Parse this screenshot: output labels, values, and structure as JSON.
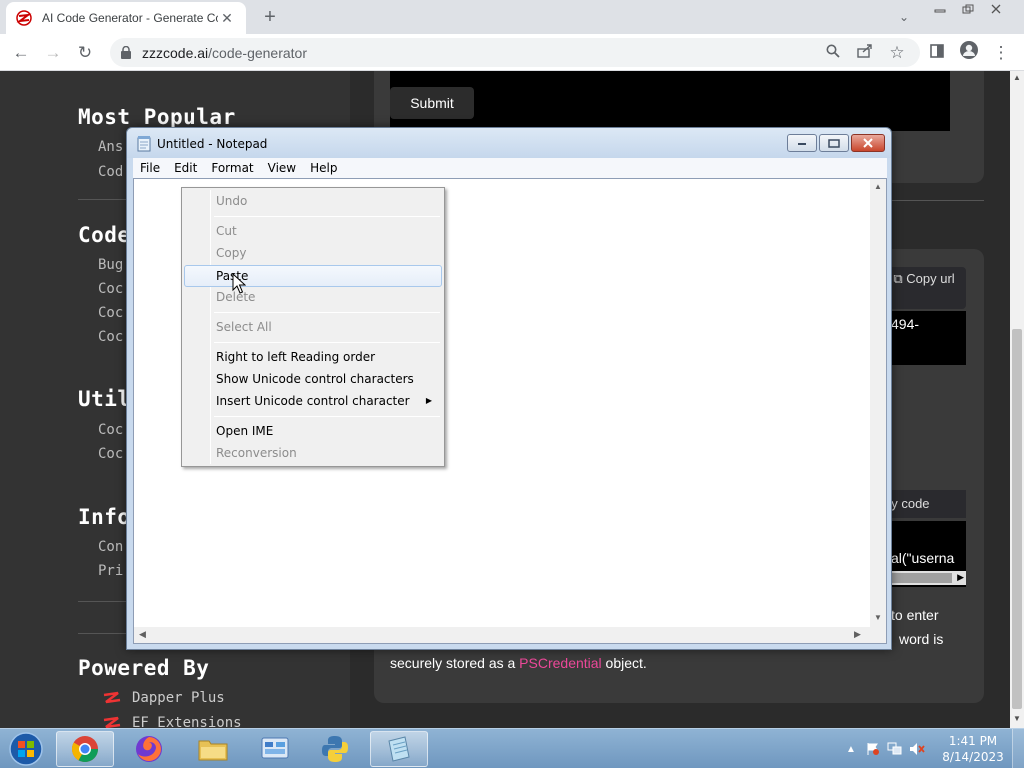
{
  "browser": {
    "tab_title": "AI Code Generator - Generate Cc",
    "url_host": "zzzcode.ai",
    "url_path": "/code-generator"
  },
  "site": {
    "sidebar": {
      "headings": [
        "Most Popular",
        "Code",
        "Util",
        "Info",
        "Powered By"
      ],
      "most_popular_links": [
        "Ans",
        "Cod"
      ],
      "code_links": [
        "Bug",
        "Coc",
        "Coc",
        "Coc"
      ],
      "util_links": [
        "Coc",
        "Coc"
      ],
      "info_links": [
        "Con",
        "Pri"
      ],
      "powered_by": [
        "Dapper Plus",
        "EF Extensions"
      ]
    },
    "main": {
      "submit_label": "Submit",
      "copy_url_label": "Copy url",
      "id_fragment": "494-",
      "copy_code_label": "py code",
      "code_fragment": "al(\"userna",
      "para_line1": "to enter",
      "para_line2": "word is",
      "para_line3_pre": "securely stored as a ",
      "para_line3_hl": "PSCredential",
      "para_line3_post": " object."
    }
  },
  "notepad": {
    "title": "Untitled - Notepad",
    "menu": [
      "File",
      "Edit",
      "Format",
      "View",
      "Help"
    ]
  },
  "context_menu": {
    "items": [
      {
        "label": "Undo",
        "enabled": false
      },
      {
        "label": "Cut",
        "enabled": false
      },
      {
        "label": "Copy",
        "enabled": false
      },
      {
        "label": "Paste",
        "enabled": true,
        "highlighted": true
      },
      {
        "label": "Delete",
        "enabled": false
      },
      {
        "label": "Select All",
        "enabled": false
      },
      {
        "label": "Right to left Reading order",
        "enabled": true
      },
      {
        "label": "Show Unicode control characters",
        "enabled": true
      },
      {
        "label": "Insert Unicode control character",
        "enabled": true,
        "submenu": true
      },
      {
        "label": "Open IME",
        "enabled": true
      },
      {
        "label": "Reconversion",
        "enabled": false
      }
    ]
  },
  "taskbar": {
    "apps": [
      "chrome-icon",
      "firefox-icon",
      "explorer-icon",
      "control-panel-icon",
      "python-icon",
      "notepad-icon"
    ],
    "time": "1:41 PM",
    "date": "8/14/2023"
  },
  "colors": {
    "site_bg": "#333333",
    "highlight_pink": "#ec4899",
    "taskbar": "#7aa2c8"
  }
}
